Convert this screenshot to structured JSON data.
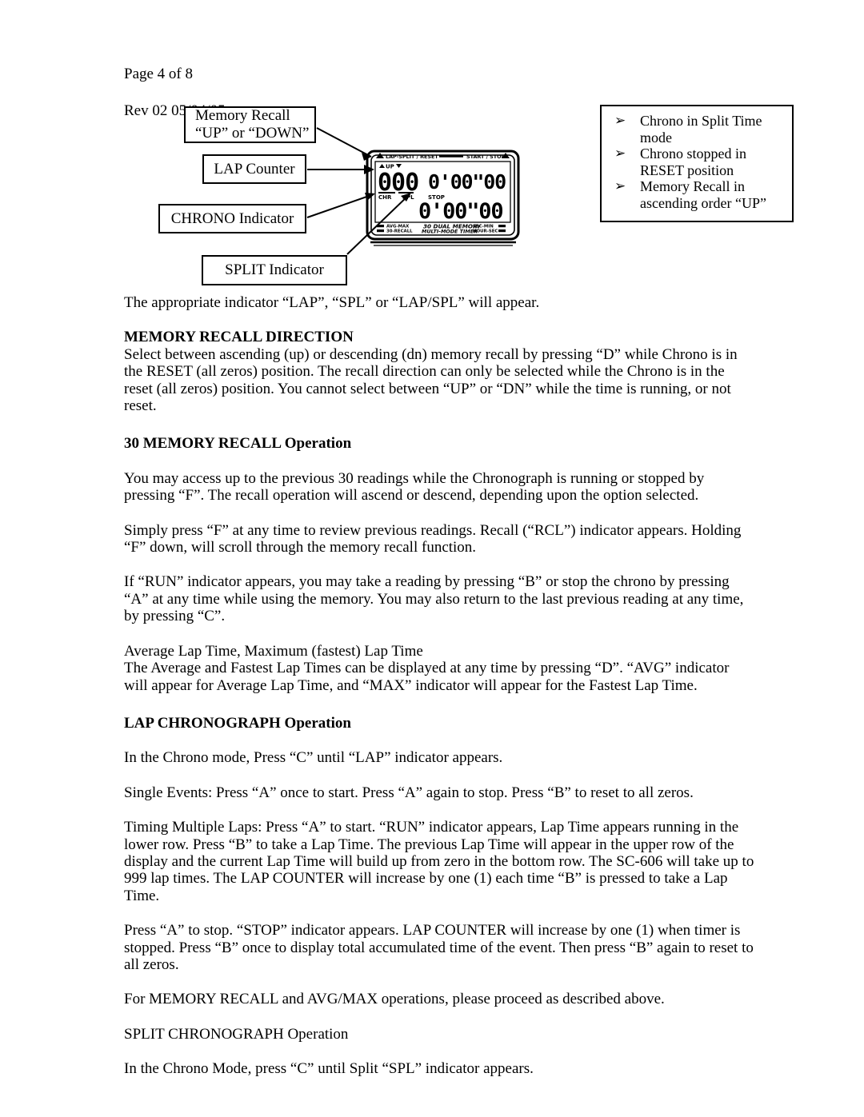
{
  "header": {
    "page_label": "Page 4 of 8",
    "revision": "Rev 02 05/04/05"
  },
  "figure": {
    "callouts": [
      {
        "id": "memory-recall",
        "line1": "Memory Recall",
        "line2": "“UP” or “DOWN”"
      },
      {
        "id": "lap-counter",
        "line1": "LAP Counter"
      },
      {
        "id": "chrono-indicator",
        "line1": "CHRONO Indicator"
      },
      {
        "id": "split-indicator",
        "line1": "SPLIT Indicator"
      }
    ],
    "status_box": {
      "bullet_glyph": "➢",
      "items": [
        "Chrono in Split Time mode",
        "Chrono stopped in RESET position",
        "Memory Recall in ascending order “UP”"
      ]
    },
    "device_display": {
      "top_left_label": "LAP-SPLIT / RESET",
      "top_right_label": "START / STOP",
      "up_indicator": "UP",
      "lap_counter_value": "000",
      "upper_time": "0'00\"00",
      "lower_time": "0'00\"00",
      "chr_label": "CHR",
      "spl_label": "SPL",
      "stop_label": "STOP",
      "bottom_left_labels": [
        "AVG-MAX",
        "30-RECALL"
      ],
      "bottom_center_label_1": "30 DUAL MEMORY",
      "bottom_center_label_2": "MULTI-MODE TIMER",
      "bottom_right_labels": [
        "SEC-MIN",
        "HOUR-SEC"
      ]
    }
  },
  "body": {
    "intro": "The appropriate indicator “LAP”, “SPL” or “LAP/SPL” will appear.",
    "section_memory_recall_direction": {
      "heading": "MEMORY RECALL DIRECTION",
      "paragraph": "Select between ascending (up) or descending (dn) memory recall by pressing “D” while Chrono is in the RESET (all zeros) position.  The recall direction can only be selected while the Chrono is in the reset (all zeros) position.  You cannot select between “UP” or “DN” while the time is running, or not reset."
    },
    "section_30_memory_recall": {
      "heading": "30 MEMORY RECALL Operation",
      "paragraph_1": "You may access up to the previous 30 readings while the Chronograph is running or stopped by pressing “F”.  The recall operation will ascend or descend, depending upon the option selected.",
      "paragraph_2": "Simply press “F” at any time to review previous readings.  Recall (“RCL”) indicator appears.  Holding “F” down, will scroll through the memory recall function.",
      "paragraph_3": "If “RUN” indicator appears, you may take a reading by pressing “B” or stop the chrono by pressing “A” at any time while using the memory.  You may also return to the last previous reading at any time, by pressing “C”.",
      "subheading_avg_max": "Average Lap Time, Maximum (fastest) Lap Time",
      "paragraph_4": "The Average and Fastest Lap Times can be displayed at any time by pressing “D”.  “AVG” indicator will appear for Average Lap Time, and “MAX” indicator will appear for the Fastest Lap Time."
    },
    "section_lap_chronograph": {
      "heading": "LAP CHRONOGRAPH Operation",
      "paragraph_1": "In the Chrono mode, Press “C” until “LAP” indicator appears.",
      "paragraph_2": "Single Events:  Press “A” once to start.  Press “A” again to stop.  Press “B” to reset to all zeros.",
      "paragraph_3": "Timing Multiple Laps:  Press “A” to start.  “RUN” indicator appears,  Lap Time appears running in the lower row.  Press “B” to take a Lap Time.  The previous Lap Time will appear in the upper row of the display and the current Lap Time will build up from zero in the bottom row.   The SC-606 will take up to 999 lap times. The LAP COUNTER will  increase by one (1) each time “B” is pressed to take a Lap Time.",
      "paragraph_4": "Press “A” to stop. “STOP” indicator appears.  LAP COUNTER will increase by one (1) when timer is stopped.  Press “B” once to display total accumulated time of the event.  Then press “B” again to reset to all zeros.",
      "paragraph_5": "For MEMORY RECALL and AVG/MAX operations, please proceed as described above."
    },
    "section_split_chronograph": {
      "heading": "SPLIT CHRONOGRAPH Operation",
      "paragraph_1": "In the Chrono Mode, press “C” until Split “SPL” indicator appears."
    }
  }
}
